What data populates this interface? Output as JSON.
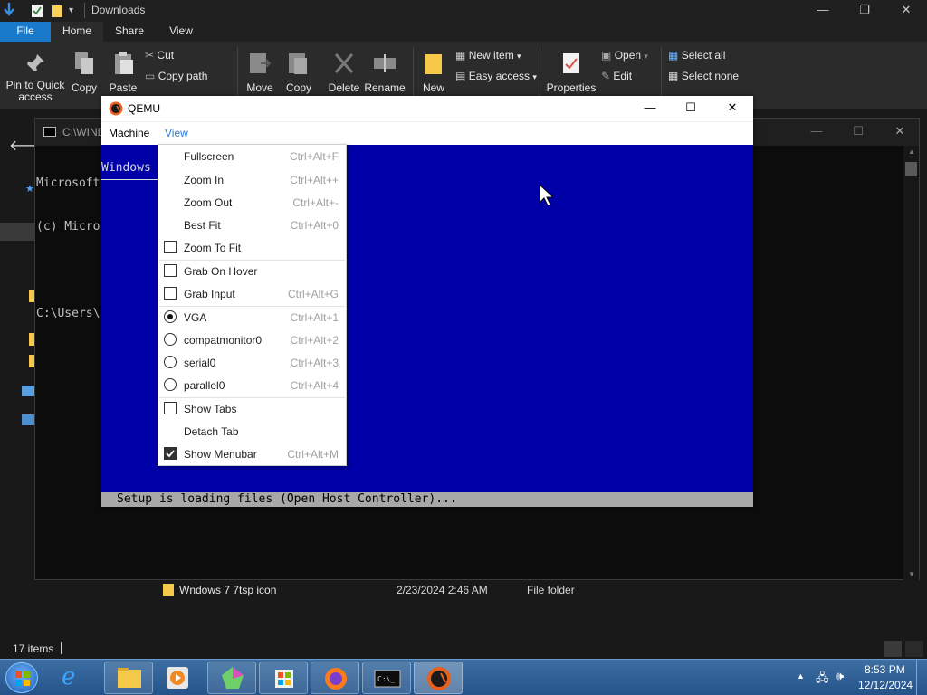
{
  "explorer": {
    "title": "Downloads",
    "tabs": [
      "File",
      "Home",
      "Share",
      "View"
    ],
    "ribbon": {
      "pin_label": "Pin to Quick access",
      "copy_label": "Copy",
      "paste_label": "Paste",
      "cut_label": "Cut",
      "copy_path_label": "Copy path",
      "move_label": "Move",
      "copy_to_label": "Copy",
      "delete_label": "Delete",
      "rename_label": "Rename",
      "new_label": "New",
      "new_item_label": "New item",
      "easy_access_label": "Easy access",
      "properties_label": "Properties",
      "open_label": "Open",
      "edit_label": "Edit",
      "select_all_label": "Select all",
      "select_none_label": "Select none"
    },
    "file_row": {
      "name": "Wndows 7 7tsp icon",
      "date": "2/23/2024 2:46 AM",
      "type": "File folder"
    },
    "status": "17 items"
  },
  "cmd": {
    "title": "C:\\WIND",
    "lines": [
      "Microsoft",
      "(c) Micro",
      "",
      "C:\\Users\\"
    ]
  },
  "qemu": {
    "title": "QEMU",
    "menus": [
      "Machine",
      "View"
    ],
    "screen_text": "Windows",
    "status_line": "Setup is loading files (Open Host Controller)..."
  },
  "view_menu": {
    "items": [
      {
        "label": "Fullscreen",
        "shortcut": "Ctrl+Alt+F"
      },
      {
        "label": "Zoom In",
        "shortcut": "Ctrl+Alt++"
      },
      {
        "label": "Zoom Out",
        "shortcut": "Ctrl+Alt+-"
      },
      {
        "label": "Best Fit",
        "shortcut": "Ctrl+Alt+0"
      },
      {
        "label": "Zoom To Fit",
        "shortcut": "",
        "check": false
      },
      {
        "label": "Grab On Hover",
        "shortcut": "",
        "check": false
      },
      {
        "label": "Grab Input",
        "shortcut": "Ctrl+Alt+G",
        "check": false
      },
      {
        "label": "VGA",
        "shortcut": "Ctrl+Alt+1",
        "radio": true
      },
      {
        "label": "compatmonitor0",
        "shortcut": "Ctrl+Alt+2",
        "radio": false
      },
      {
        "label": "serial0",
        "shortcut": "Ctrl+Alt+3",
        "radio": false
      },
      {
        "label": "parallel0",
        "shortcut": "Ctrl+Alt+4",
        "radio": false
      },
      {
        "label": "Show Tabs",
        "shortcut": "",
        "check": false
      },
      {
        "label": "Detach Tab",
        "shortcut": ""
      },
      {
        "label": "Show Menubar",
        "shortcut": "Ctrl+Alt+M",
        "check": true
      }
    ]
  },
  "taskbar": {
    "time": "8:53 PM",
    "date": "12/12/2024"
  },
  "colors": {
    "qemu_screen": "#0000a8",
    "file_tab": "#1979ca",
    "menu_accent": "#2a7ad6"
  }
}
